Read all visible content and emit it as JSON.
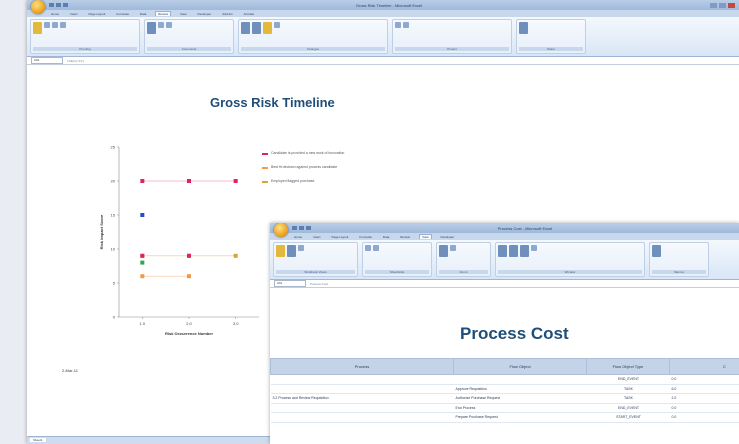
{
  "back_window": {
    "title": "Gross Risk Timeline - Microsoft Excel",
    "tabs": [
      "Home",
      "Insert",
      "Page Layout",
      "Formulas",
      "Data",
      "Review",
      "View",
      "Developer",
      "Add-Ins",
      "Acrobat"
    ],
    "active_tab": 5,
    "ribbon_groups": [
      "Proofing",
      "Comments",
      "Changes",
      "Protect",
      "Share"
    ],
    "name_box": "A94",
    "formula": "=CELL(\"A1\")",
    "sheet_tab": "Sheet1"
  },
  "chart_title": "Gross Risk Timeline",
  "chart_note": "2-Mar-11",
  "chart_data": {
    "type": "scatter",
    "title": "Gross Risk Timeline",
    "xlabel": "Risk Occurrence Number",
    "ylabel": "Risk Impact Score",
    "x_ticks": [
      "1.0",
      "2.0",
      "3.0"
    ],
    "y_ticks": [
      "0",
      "5",
      "10",
      "15",
      "20",
      "25"
    ],
    "ylim": [
      0,
      25
    ],
    "grid": false,
    "legend_position": "right",
    "series": [
      {
        "name": "Candidate is provided a new work of innovation",
        "color": "#e0245a",
        "x": [
          1,
          2,
          3
        ],
        "y": [
          20,
          20,
          20
        ],
        "line": true
      },
      {
        "name": "Best fit decision against process candidate",
        "color": "#f39a4a",
        "x": [
          1,
          2
        ],
        "y": [
          6,
          6
        ],
        "line": true
      },
      {
        "name": "Employed flagged purchase",
        "color": "#d9a23a",
        "x": [
          1,
          2,
          3
        ],
        "y": [
          9,
          9,
          9
        ],
        "line": true
      },
      {
        "name": "",
        "color": "#1f4fc4",
        "x": [
          1
        ],
        "y": [
          15
        ],
        "line": false
      },
      {
        "name": "",
        "color": "#3aa64a",
        "x": [
          1
        ],
        "y": [
          8
        ],
        "line": false
      },
      {
        "name": "",
        "color": "#e0245a",
        "x": [
          1,
          2
        ],
        "y": [
          9,
          9
        ],
        "line": false
      }
    ]
  },
  "front_window": {
    "title": "Process Cost - Microsoft Excel",
    "tabs": [
      "Home",
      "Insert",
      "Page Layout",
      "Formulas",
      "Data",
      "Review",
      "View",
      "Developer",
      "Add-Ins",
      "Acrobat"
    ],
    "active_tab": 6,
    "ribbon_groups": [
      "Workbook Views",
      "Show/Hide",
      "Zoom",
      "Window",
      "Macros"
    ],
    "name_box": "A91",
    "formula": "Process Cost"
  },
  "process_title": "Process Cost",
  "table": {
    "headers": [
      "Process",
      "Flow Object",
      "Flow Object Type",
      "C"
    ],
    "rows": [
      {
        "process": "",
        "flow_object": "",
        "type": "END_EVENT",
        "cost": "0.0"
      },
      {
        "process": "",
        "flow_object": "Approve Requisition",
        "type": "TASK",
        "cost": "6.0"
      },
      {
        "process": "3.2 Process and Review Requisition",
        "flow_object": "Authorize Purchase Request",
        "type": "TASK",
        "cost": "2.0"
      },
      {
        "process": "",
        "flow_object": "End Process",
        "type": "END_EVENT",
        "cost": "0.0"
      },
      {
        "process": "",
        "flow_object": "Prepare Purchase Request",
        "type": "START_EVENT",
        "cost": "0.0"
      }
    ]
  }
}
